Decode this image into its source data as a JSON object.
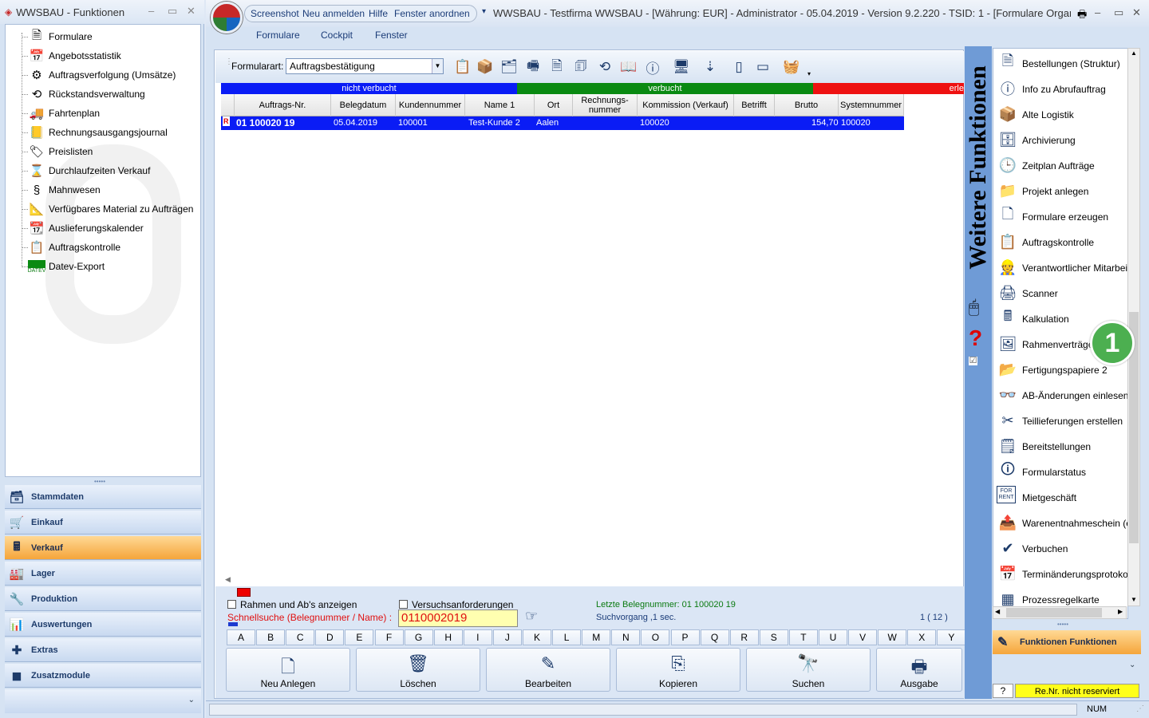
{
  "left_window": {
    "title": "WWSBAU - Funktionen",
    "tree": [
      {
        "label": "Formulare",
        "icon": "document-icon"
      },
      {
        "label": "Angebotsstatistik",
        "icon": "calendar-chart-icon"
      },
      {
        "label": "Auftragsverfolgung (Umsätze)",
        "icon": "tracking-icon"
      },
      {
        "label": "Rückstandsverwaltung",
        "icon": "clock-back-icon"
      },
      {
        "label": "Fahrtenplan",
        "icon": "truck-icon"
      },
      {
        "label": "Rechnungsausgangsjournal",
        "icon": "journal-icon"
      },
      {
        "label": "Preislisten",
        "icon": "tag-icon"
      },
      {
        "label": "Durchlaufzeiten Verkauf",
        "icon": "hourglass-icon"
      },
      {
        "label": "Mahnwesen",
        "icon": "paragraph-icon"
      },
      {
        "label": "Verfügbares Material zu Aufträgen",
        "icon": "material-icon"
      },
      {
        "label": "Auslieferungskalender",
        "icon": "calendar-12-icon"
      },
      {
        "label": "Auftragskontrolle",
        "icon": "clipboard-check-icon"
      },
      {
        "label": "Datev-Export",
        "icon": "datev-icon",
        "icon_text": "DATEV"
      }
    ],
    "nav": [
      {
        "label": "Stammdaten",
        "icon": "stammdaten-icon"
      },
      {
        "label": "Einkauf",
        "icon": "cart-icon"
      },
      {
        "label": "Verkauf",
        "icon": "register-icon",
        "active": true
      },
      {
        "label": "Lager",
        "icon": "warehouse-icon"
      },
      {
        "label": "Produktion",
        "icon": "production-icon"
      },
      {
        "label": "Auswertungen",
        "icon": "analysis-icon"
      },
      {
        "label": "Extras",
        "icon": "extras-icon"
      },
      {
        "label": "Zusatzmodule",
        "icon": "modules-icon"
      }
    ]
  },
  "main_window": {
    "quick": [
      "Screenshot",
      "Neu anmelden",
      "Hilfe",
      "Fenster anordnen"
    ],
    "title": "WWSBAU - Testfirma WWSBAU - [Währung: EUR] - Administrator - 05.04.2019 - Version 9.2.220 - TSID: 1 - [Formulare Organi",
    "menu": [
      "Formulare",
      "Cockpit",
      "Fenster"
    ]
  },
  "toolbar": {
    "label": "Formularart:",
    "value": "Auftragsbestätigung"
  },
  "bands": [
    {
      "label": "nicht verbucht",
      "color": "#0a1cf5"
    },
    {
      "label": "verbucht",
      "color": "#0a8a12"
    },
    {
      "label": "erle",
      "color": "#ee1111"
    }
  ],
  "grid": {
    "headers": [
      "Auftrags-Nr.",
      "Belegdatum",
      "Kundennummer",
      "Name 1",
      "Ort",
      "Rechnungs-\nnummer",
      "Kommission (Verkauf)",
      "Betrifft",
      "Brutto",
      "Systemnummer"
    ],
    "row": {
      "nr": "01 100020 19",
      "datum": "05.04.2019",
      "kunde": "100001",
      "name": "Test-Kunde 2",
      "ort": "Aalen",
      "rechnung": "",
      "kommission": "100020",
      "betrifft": "",
      "brutto": "154,70",
      "system": "100020"
    }
  },
  "bottom": {
    "chk1": "Rahmen und Ab's anzeigen",
    "chk2": "Versuchsanforderungen",
    "search_label": "Schnellsuche (Belegnummer / Name) :",
    "search_value": "0110002019",
    "last": "Letzte Belegnummer: 01 100020 19",
    "suchvorgang": "Suchvorgang ,1 sec.",
    "count": "1 ( 12 )",
    "letters": [
      "A",
      "B",
      "C",
      "D",
      "E",
      "F",
      "G",
      "H",
      "I",
      "J",
      "K",
      "L",
      "M",
      "N",
      "O",
      "P",
      "Q",
      "R",
      "S",
      "T",
      "U",
      "V",
      "W",
      "X",
      "Y"
    ],
    "buttons": [
      {
        "label": "Neu Anlegen",
        "icon": "new-doc-icon"
      },
      {
        "label": "Löschen",
        "icon": "trash-icon"
      },
      {
        "label": "Bearbeiten",
        "icon": "edit-icon"
      },
      {
        "label": "Kopieren",
        "icon": "copy-icon"
      },
      {
        "label": "Suchen",
        "icon": "binoculars-icon"
      },
      {
        "label": "Ausgabe",
        "icon": "printer-icon"
      }
    ]
  },
  "right_panel": {
    "vertical_title": "Weitere Funktionen",
    "items": [
      {
        "label": "Bestellungen (Struktur)",
        "icon": "order-structure-icon"
      },
      {
        "label": "Info zu Abrufauftrag",
        "icon": "info-doc-icon"
      },
      {
        "label": "Alte Logistik",
        "icon": "box-icon"
      },
      {
        "label": "Archivierung",
        "icon": "archive-icon"
      },
      {
        "label": "Zeitplan Aufträge",
        "icon": "schedule-icon"
      },
      {
        "label": "Projekt anlegen",
        "icon": "project-icon"
      },
      {
        "label": "Formulare erzeugen",
        "icon": "form-create-icon"
      },
      {
        "label": "Auftragskontrolle",
        "icon": "clipboard-check-icon"
      },
      {
        "label": "Verantwortlicher Mitarbeiter",
        "icon": "worker-icon"
      },
      {
        "label": "Scanner",
        "icon": "scanner-icon"
      },
      {
        "label": "Kalkulation",
        "icon": "calculator-icon"
      },
      {
        "label": "Rahmenverträge",
        "icon": "picture-icon"
      },
      {
        "label": "Fertigungspapiere 2",
        "icon": "folder-icon"
      },
      {
        "label": "AB-Änderungen einlesen",
        "icon": "glasses-icon"
      },
      {
        "label": "Teillieferungen erstellen",
        "icon": "partial-icon"
      },
      {
        "label": "Bereitstellungen",
        "icon": "provision-icon"
      },
      {
        "label": "Formularstatus",
        "icon": "status-doc-icon"
      },
      {
        "label": "Mietgeschäft",
        "icon": "for-rent-icon",
        "icon_text": "FOR RENT"
      },
      {
        "label": "Warenentnahmeschein (ein",
        "icon": "withdrawal-icon"
      },
      {
        "label": "Verbuchen",
        "icon": "post-icon"
      },
      {
        "label": "Terminänderungsprotokoll",
        "icon": "date-change-icon"
      },
      {
        "label": "Prozessregelkarte",
        "icon": "grid-icon"
      }
    ],
    "func_button": "Funktionen Funktionen",
    "help": "?",
    "renr": "Re.Nr. nicht reserviert",
    "num": "NUM",
    "badge": "1"
  }
}
